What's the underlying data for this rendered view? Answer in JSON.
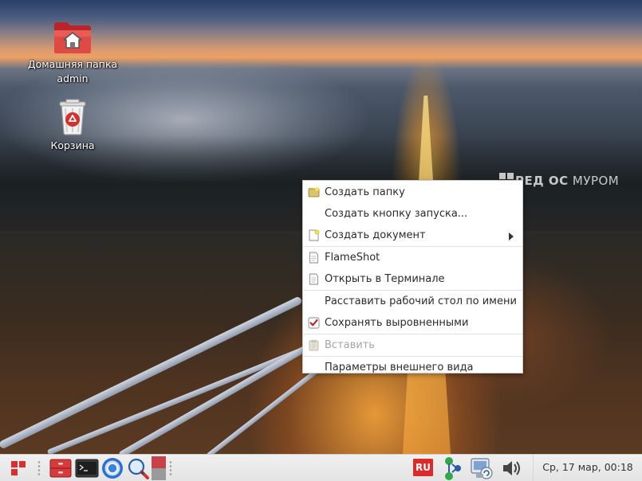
{
  "desktop": {
    "icons": [
      {
        "label_line1": "Домашняя папка",
        "label_line2": "admin",
        "icon": "home-folder-icon"
      },
      {
        "label": "Корзина",
        "icon": "trash-icon"
      }
    ],
    "watermark": {
      "bold": "РЕД ОС",
      "rest": "МУРОМ"
    }
  },
  "context_menu": {
    "items": [
      {
        "label": "Создать папку",
        "icon": "new-folder-icon",
        "enabled": true
      },
      {
        "label": "Создать кнопку запуска...",
        "icon": null,
        "enabled": true
      },
      {
        "label": "Создать документ",
        "icon": "new-document-icon",
        "enabled": true,
        "submenu": true
      },
      {
        "label": "FlameShot",
        "icon": "document-icon",
        "enabled": true
      },
      {
        "label": "Открыть в Терминале",
        "icon": "document-icon",
        "enabled": true
      },
      {
        "label": "Расставить рабочий стол по имени",
        "icon": null,
        "enabled": true
      },
      {
        "label": "Сохранять выровненными",
        "icon": "checkbox-checked-icon",
        "enabled": true,
        "checked": true
      },
      {
        "label": "Вставить",
        "icon": "paste-icon",
        "enabled": false
      },
      {
        "label": "Параметры внешнего вида",
        "icon": null,
        "enabled": true
      }
    ]
  },
  "taskbar": {
    "launchers": [
      "file-manager-icon",
      "terminal-icon",
      "web-browser-icon",
      "search-icon",
      "window-switcher-icon"
    ],
    "tray": {
      "keyboard_layout": "RU",
      "icons": [
        "network-status-icon",
        "update-manager-icon",
        "volume-icon"
      ]
    },
    "clock": "Ср, 17 мар, 00:18"
  },
  "colors": {
    "accent_red": "#dd2b2b",
    "menu_bg": "#ffffff",
    "taskbar_bg": "#ececec"
  }
}
